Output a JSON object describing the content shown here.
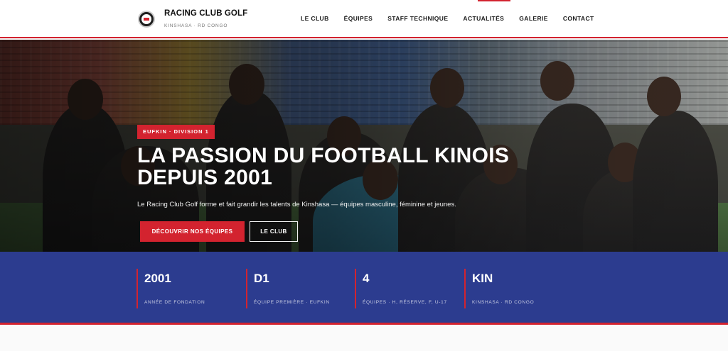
{
  "header": {
    "brand_name": "RACING CLUB GOLF",
    "brand_sub": "KINSHASA · RD CONGO",
    "nav": [
      "LE CLUB",
      "ÉQUIPES",
      "STAFF TECHNIQUE",
      "ACTUALITÉS",
      "GALERIE",
      "CONTACT"
    ]
  },
  "hero": {
    "badge": "EUFKIN · DIVISION 1",
    "title_line1": "LA PASSION DU FOOTBALL KINOIS",
    "title_line2": "DEPUIS 2001",
    "text": "Le Racing Club Golf forme et fait grandir les talents de Kinshasa — équipes masculine, féminine et jeunes.",
    "primary_button": "DÉCOUVRIR NOS ÉQUIPES",
    "secondary_button": "LE CLUB"
  },
  "stats": [
    {
      "value": "2001",
      "label": "ANNÉE DE FONDATION"
    },
    {
      "value": "D1",
      "label": "ÉQUIPE PREMIÈRE · EUFKIN"
    },
    {
      "value": "4",
      "label": "ÉQUIPES · H, RÉSERVE, F, U-17"
    },
    {
      "value": "KIN",
      "label": "KINSHASA · RD CONGO"
    }
  ],
  "colors": {
    "accent": "#d3232f",
    "navy": "#2c3c8f"
  }
}
